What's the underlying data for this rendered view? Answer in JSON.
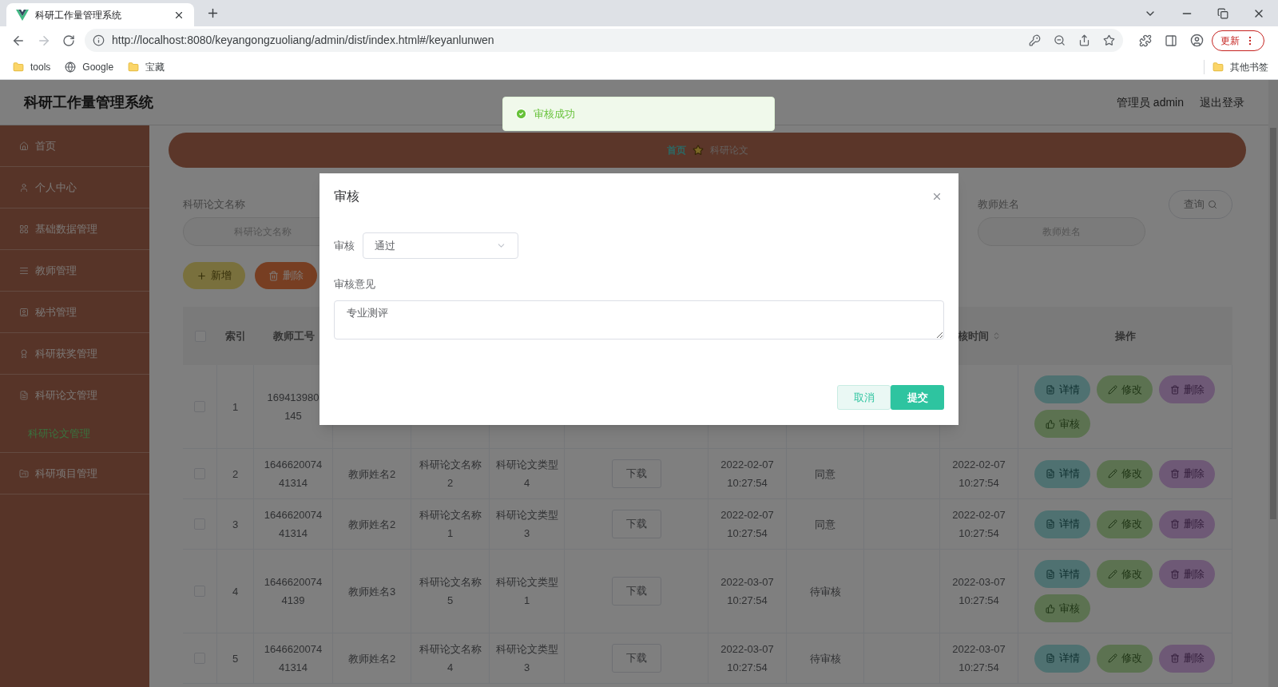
{
  "browser": {
    "tab_title": "科研工作量管理系统",
    "url": "http://localhost:8080/keyangongzuoliang/admin/dist/index.html#/keyanlunwen",
    "update_button": "更新",
    "bookmarks": [
      {
        "kind": "folder",
        "label": "tools"
      },
      {
        "kind": "site",
        "label": "Google"
      },
      {
        "kind": "folder",
        "label": "宝藏"
      }
    ],
    "other_bookmarks": "其他书签"
  },
  "header": {
    "title": "科研工作量管理系统",
    "user": "管理员 admin",
    "logout": "退出登录"
  },
  "sidebar": {
    "items": [
      {
        "label": "首页"
      },
      {
        "label": "个人中心"
      },
      {
        "label": "基础数据管理"
      },
      {
        "label": "教师管理"
      },
      {
        "label": "秘书管理"
      },
      {
        "label": "科研获奖管理"
      },
      {
        "label": "科研论文管理",
        "children": [
          {
            "label": "科研论文管理",
            "selected": true
          }
        ]
      },
      {
        "label": "科研项目管理"
      }
    ]
  },
  "breadcrumb": [
    "首页",
    "科研论文"
  ],
  "search": {
    "fields": [
      {
        "label": "科研论文名称",
        "placeholder": "科研论文名称"
      },
      {
        "label": "教师姓名",
        "placeholder": "教师姓名"
      }
    ],
    "query_button": "查询"
  },
  "actions": [
    {
      "kind": "add",
      "label": "新增"
    },
    {
      "kind": "delete",
      "label": "删除"
    }
  ],
  "table": {
    "header_checked": false,
    "columns": [
      {
        "kind": "index",
        "label": "索引"
      },
      {
        "kind": "teacher_id",
        "label": "教师工号"
      },
      {
        "kind": "review_time",
        "label": "核时间",
        "sortable": true
      },
      {
        "kind": "actions",
        "label": "操作"
      }
    ],
    "rows": [
      {
        "checked": false,
        "index": "1",
        "teacher_id": "169413980 145",
        "actions": [
          {
            "kind": "detail",
            "label": "详情"
          },
          {
            "kind": "edit",
            "label": "修改"
          },
          {
            "kind": "delete",
            "label": "删除"
          },
          {
            "kind": "review",
            "label": "审核"
          }
        ]
      },
      {
        "checked": false,
        "index": "2",
        "teacher_id": "164662007441314",
        "teacher_name": "教师姓名2",
        "paper_name": "科研论文名称2",
        "paper_type": "科研论文类型4",
        "file_button": "下载",
        "date": "2022-02-07 10:27:54",
        "status": "同意",
        "review_time": "2022-02-07 10:27:54",
        "actions": [
          {
            "kind": "detail",
            "label": "详情"
          },
          {
            "kind": "edit",
            "label": "修改"
          },
          {
            "kind": "delete",
            "label": "删除"
          }
        ]
      },
      {
        "checked": false,
        "index": "3",
        "teacher_id": "164662007441314",
        "teacher_name": "教师姓名2",
        "paper_name": "科研论文名称1",
        "paper_type": "科研论文类型3",
        "file_button": "下载",
        "date": "2022-02-07 10:27:54",
        "status": "同意",
        "review_time": "2022-02-07 10:27:54",
        "actions": [
          {
            "kind": "detail",
            "label": "详情"
          },
          {
            "kind": "edit",
            "label": "修改"
          },
          {
            "kind": "delete",
            "label": "删除"
          }
        ]
      },
      {
        "checked": false,
        "index": "4",
        "teacher_id": "16466200744139",
        "teacher_name": "教师姓名3",
        "paper_name": "科研论文名称5",
        "paper_type": "科研论文类型1",
        "file_button": "下载",
        "date": "2022-03-07 10:27:54",
        "status": "待审核",
        "review_time": "2022-03-07 10:27:54",
        "actions": [
          {
            "kind": "detail",
            "label": "详情"
          },
          {
            "kind": "edit",
            "label": "修改"
          },
          {
            "kind": "delete",
            "label": "删除"
          },
          {
            "kind": "review",
            "label": "审核"
          }
        ]
      },
      {
        "checked": false,
        "index": "5",
        "teacher_id": "164662007441314",
        "teacher_name": "教师姓名2",
        "paper_name": "科研论文名称4",
        "paper_type": "科研论文类型3",
        "file_button": "下载",
        "date": "2022-03-07 10:27:54",
        "status": "待审核",
        "review_time": "2022-03-07 10:27:54",
        "actions": [
          {
            "kind": "detail",
            "label": "详情"
          },
          {
            "kind": "edit",
            "label": "修改"
          },
          {
            "kind": "delete",
            "label": "删除"
          }
        ]
      }
    ]
  },
  "toast": {
    "kind": "success",
    "message": "审核成功"
  },
  "dialog": {
    "title": "审核",
    "fields": [
      {
        "kind": "select",
        "label": "审核",
        "value": "通过"
      },
      {
        "kind": "textarea",
        "label": "审核意见",
        "value": "专业测评"
      }
    ],
    "buttons": [
      {
        "kind": "cancel",
        "label": "取消"
      },
      {
        "kind": "submit",
        "label": "提交"
      }
    ]
  }
}
